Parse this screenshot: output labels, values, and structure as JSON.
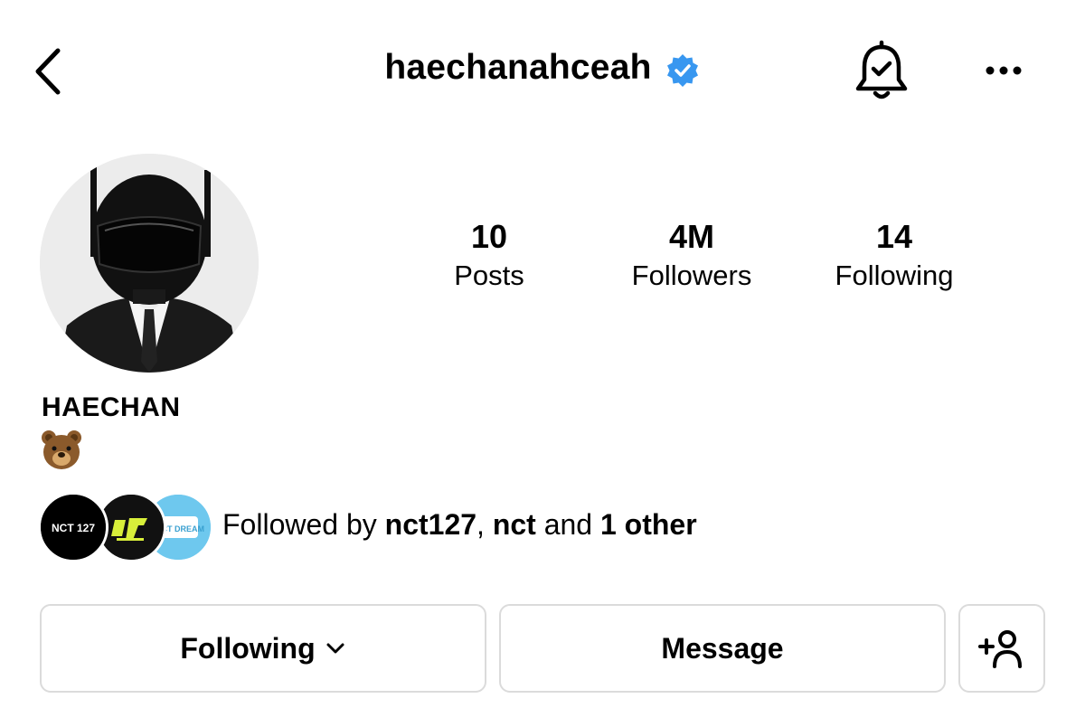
{
  "header": {
    "username": "haechanahceah",
    "icons": {
      "back": "back-chevron-icon",
      "verified": "verified-badge-icon",
      "notifications": "bell-check-icon",
      "more": "more-dots-icon"
    }
  },
  "colors": {
    "verified": "#3897f0",
    "border": "#dbdbdb",
    "text": "#000000"
  },
  "stats": [
    {
      "value": "10",
      "label": "Posts"
    },
    {
      "value": "4M",
      "label": "Followers"
    },
    {
      "value": "14",
      "label": "Following"
    }
  ],
  "profile": {
    "display_name": "HAECHAN",
    "bio_emoji": "bear-face-emoji"
  },
  "followed_by": {
    "prefix": "Followed by ",
    "user1": "nct127",
    "separator": ", ",
    "user2": "nct",
    "conjunction": " and ",
    "others": "1 other",
    "avatars": [
      {
        "label": "NCT 127"
      },
      {
        "label": "nct-logo"
      },
      {
        "label": "NCT DREAM"
      }
    ]
  },
  "actions": {
    "following_label": "Following",
    "message_label": "Message",
    "add_user_icon": "add-user-icon"
  }
}
